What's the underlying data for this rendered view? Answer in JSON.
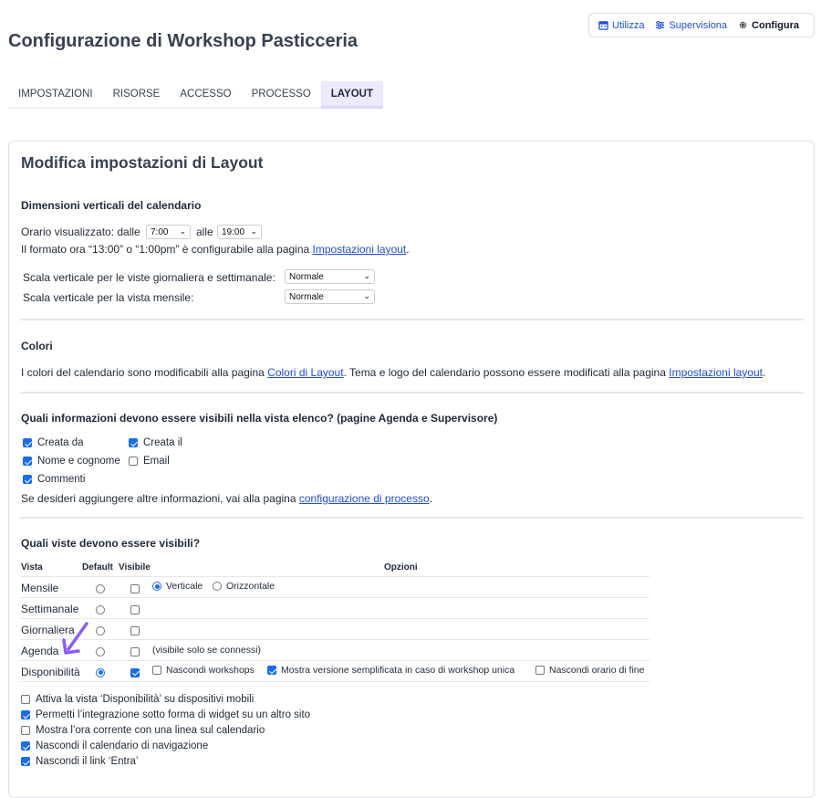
{
  "topnav": {
    "items": [
      {
        "label": "Utilizza",
        "icon": "calendar-icon"
      },
      {
        "label": "Supervisiona",
        "icon": "sliders-icon"
      },
      {
        "label": "Configura",
        "icon": "gear-icon"
      }
    ],
    "active": "Configura"
  },
  "page_title": "Configurazione di Workshop Pasticceria",
  "tabs": [
    "IMPOSTAZIONI",
    "RISORSE",
    "ACCESSO",
    "PROCESSO",
    "LAYOUT"
  ],
  "active_tab": "LAYOUT",
  "card_title": "Modifica impostazioni di Layout",
  "calendar_dims": {
    "title": "Dimensioni verticali del calendario",
    "hours_label": "Orario visualizzato: dalle",
    "from": "7:00",
    "to_label": "alle",
    "to": "19:00",
    "format_text": "Il formato ora “13:00” o “1:00pm” è configurabile alla pagina",
    "format_link": "Impostazioni layout",
    "scale_day_week_label": "Scala verticale per le viste giornaliera e settimanale:",
    "scale_day_week_value": "Normale",
    "scale_month_label": "Scala verticale per la vista mensile:",
    "scale_month_value": "Normale"
  },
  "colors": {
    "title": "Colori",
    "text1": "I colori del calendario sono modificabili alla pagina",
    "link1": "Colori di Layout",
    "text2": ". Tema e logo del calendario possono essere modificati alla pagina",
    "link2": "Impostazioni layout"
  },
  "list_info": {
    "title": "Quali informazioni devono essere visibili nella vista elenco? (pagine Agenda e Supervisore)",
    "options": [
      {
        "label": "Creata da",
        "checked": true
      },
      {
        "label": "Creata il",
        "checked": true
      },
      {
        "label": "Nome e cognome",
        "checked": true
      },
      {
        "label": "Email",
        "checked": false
      },
      {
        "label": "Commenti",
        "checked": true
      }
    ],
    "more_text": "Se desideri aggiungere altre informazioni, vai alla pagina",
    "more_link": "configurazione di processo"
  },
  "views": {
    "title": "Quali viste devono essere visibili?",
    "headers": {
      "view": "Vista",
      "default": "Default",
      "visible": "Visibile",
      "options": "Opzioni"
    },
    "rows": [
      {
        "name": "Mensile",
        "default": false,
        "visible": false
      },
      {
        "name": "Settimanale",
        "default": false,
        "visible": false
      },
      {
        "name": "Giornaliera",
        "default": false,
        "visible": false
      },
      {
        "name": "Agenda",
        "default": false,
        "visible": false,
        "note": "(visibile solo se connessi)"
      },
      {
        "name": "Disponibilità",
        "default": true,
        "visible": true
      }
    ],
    "monthly_orientation": {
      "vertical": "Verticale",
      "horizontal": "Orizzontale",
      "selected": "Verticale"
    },
    "availability_options": [
      {
        "label": "Nascondi workshops",
        "checked": false
      },
      {
        "label": "Mostra versione semplificata in caso di workshop unica",
        "checked": true
      },
      {
        "label": "Nascondi orario di fine",
        "checked": false
      }
    ]
  },
  "extra_options": [
    {
      "label": "Attiva la vista ‘Disponibilità’ su dispositivi mobili",
      "checked": false
    },
    {
      "label": "Permetti l’integrazione sotto forma di widget su un altro sito",
      "checked": true
    },
    {
      "label": "Mostra l’ora corrente con una linea sul calendario",
      "checked": false
    },
    {
      "label": "Nascondi il calendario di navigazione",
      "checked": true
    },
    {
      "label": "Nascondi il link ‘Entra’",
      "checked": true
    }
  ],
  "colors_theme": {
    "accent": "#1a6ce8",
    "tab_active_bg": "#ede9fe",
    "annotation_arrow": "#8b5cf6"
  }
}
